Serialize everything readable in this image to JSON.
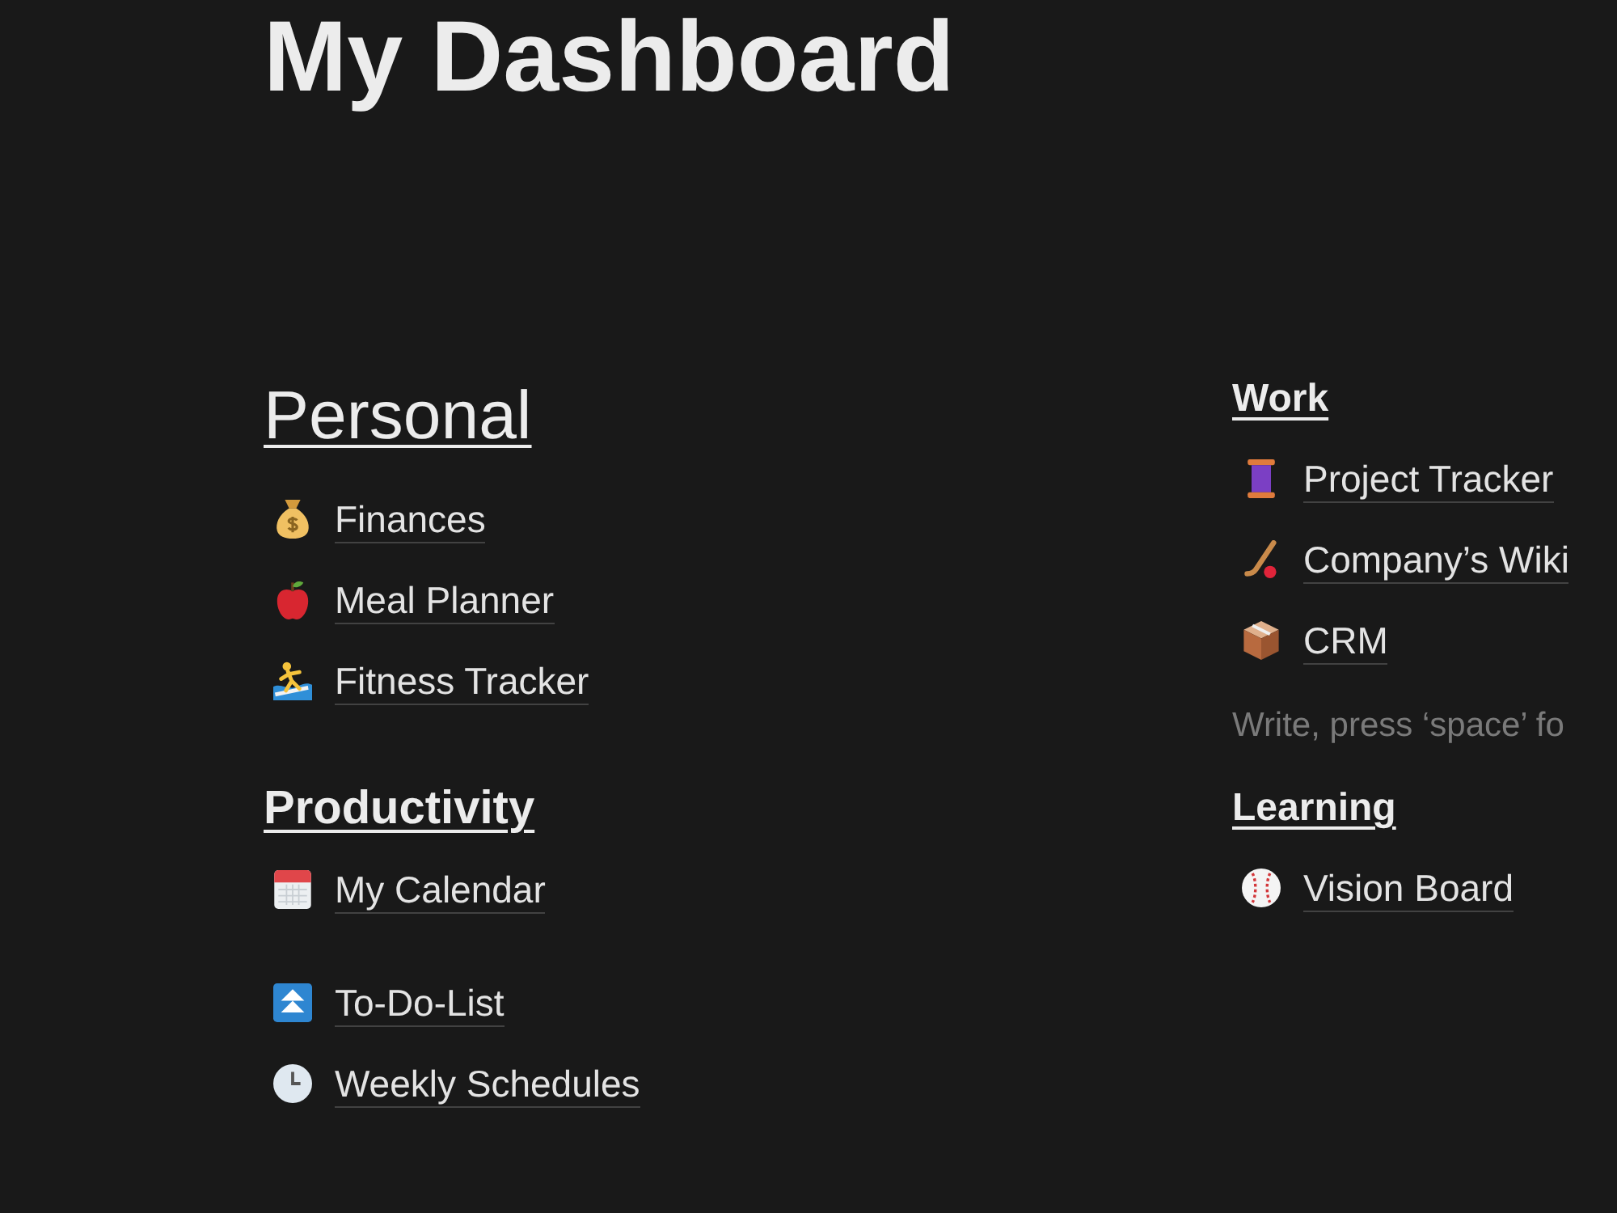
{
  "title": "My Dashboard",
  "columns": [
    {
      "sections": [
        {
          "kind": "h1",
          "heading": "Personal",
          "items": [
            {
              "label": "Finances"
            },
            {
              "label": "Meal Planner"
            },
            {
              "label": "Fitness Tracker"
            }
          ]
        },
        {
          "kind": "h2",
          "heading": "Productivity",
          "items": [
            {
              "label": "My Calendar"
            },
            {
              "label": "To-Do-List"
            },
            {
              "label": "Weekly Schedules"
            }
          ]
        }
      ]
    },
    {
      "sections": [
        {
          "kind": "h3",
          "heading": "Work",
          "items": [
            {
              "label": "Project Tracker"
            },
            {
              "label": "Company’s Wiki"
            },
            {
              "label": "CRM"
            }
          ],
          "placeholder": "Write, press ‘space’ fo"
        },
        {
          "kind": "h3",
          "heading": "Learning",
          "items": [
            {
              "label": "Vision Board"
            }
          ]
        }
      ]
    }
  ]
}
